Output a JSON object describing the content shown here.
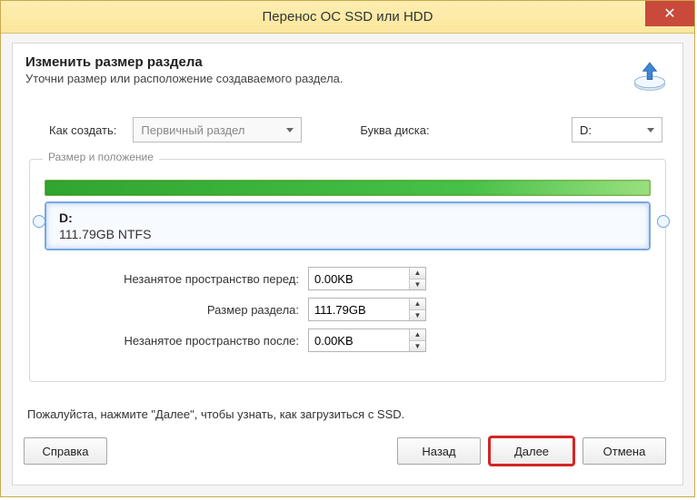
{
  "window": {
    "title": "Перенос ОС SSD или HDD"
  },
  "header": {
    "title": "Изменить размер раздела",
    "subtitle": "Уточни размер или расположение создаваемого раздела."
  },
  "create": {
    "label": "Как создать:",
    "value": "Первичный раздел"
  },
  "drive": {
    "label": "Буква диска:",
    "value": "D:"
  },
  "fieldset": {
    "legend": "Размер и положение"
  },
  "partition": {
    "name": "D:",
    "size_text": "111.79GB NTFS"
  },
  "fields": {
    "before_label": "Незанятое пространство перед:",
    "before_value": "0.00KB",
    "size_label": "Размер раздела:",
    "size_value": "111.79GB",
    "after_label": "Незанятое пространство после:",
    "after_value": "0.00KB"
  },
  "hint": "Пожалуйста, нажмите \"Далее\", чтобы узнать, как загрузиться с SSD.",
  "buttons": {
    "help": "Справка",
    "back": "Назад",
    "next": "Далее",
    "cancel": "Отмена"
  }
}
